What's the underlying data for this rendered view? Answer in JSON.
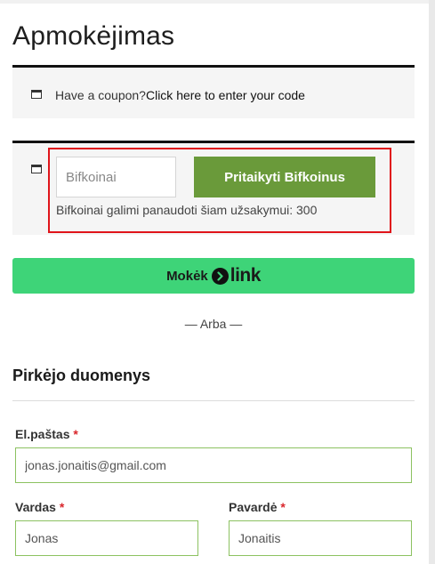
{
  "page": {
    "title": "Apmokėjimas"
  },
  "coupon_notice": {
    "prefix": "Have a coupon?",
    "link": "Click here to enter your code"
  },
  "bifkoinai": {
    "placeholder": "Bifkoinai",
    "apply_button": "Pritaikyti Bifkoinus",
    "info": "Bifkoinai galimi panaudoti šiam užsakymui: 300"
  },
  "link_pay": {
    "label": "Mokėk",
    "brand": "link"
  },
  "separator": "— Arba —",
  "buyer_section": {
    "title": "Pirkėjo duomenys",
    "required_mark": "*",
    "fields": {
      "email": {
        "label": "El.paštas",
        "value": "jonas.jonaitis@gmail.com"
      },
      "first_name": {
        "label": "Vardas",
        "value": "Jonas"
      },
      "last_name": {
        "label": "Pavardė",
        "value": "Jonaitis"
      }
    }
  },
  "colors": {
    "apply_button": "#6a9a3a",
    "link_button": "#3ed478",
    "highlight_border": "#e0141a",
    "input_border": "#8cc261",
    "required": "#d9262b"
  }
}
